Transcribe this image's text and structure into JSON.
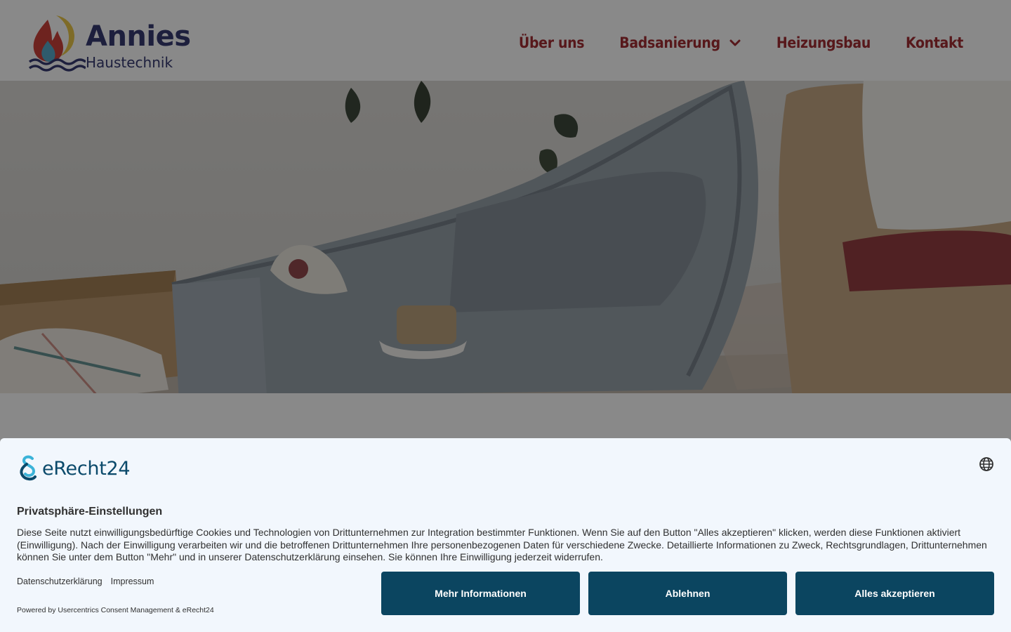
{
  "brand": {
    "name": "Annies",
    "subtitle": "Haustechnik",
    "colors": {
      "flame_red": "#c8322a",
      "flame_blue": "#4aa3c4",
      "moon_yellow": "#e8c23a",
      "text_navy": "#262a66"
    }
  },
  "nav": {
    "items": [
      {
        "label": "Über uns"
      },
      {
        "label": "Badsanierung",
        "icon": "chevron-down-icon"
      },
      {
        "label": "Heizungsbau"
      },
      {
        "label": "Kontakt"
      }
    ],
    "color": "#9b1c22"
  },
  "hero": {
    "image": "bathtub-photo"
  },
  "consent": {
    "logo_text": "eRecht24",
    "language_icon": "globe-icon",
    "title": "Privatsphäre-Einstellungen",
    "text": "Diese Seite nutzt einwilligungsbedürftige Cookies und Technologien von Drittunternehmen zur Integration bestimmter Funktionen. Wenn Sie auf den Button \"Alles akzeptieren\" klicken, werden diese Funktionen aktiviert (Einwilligung). Nach der Einwilligung verarbeiten wir und die betroffenen Drittunternehmen Ihre personenbezogenen Daten für verschiedene Zwecke. Detaillierte Informationen zu Zweck, Rechtsgrundlagen, Drittunternehmen können Sie unter dem Button \"Mehr\" und in unserer Datenschutzerklärung einsehen. Sie können Ihre Einwilligung jederzeit widerrufen.",
    "links": {
      "privacy": "Datenschutzerklärung",
      "imprint": "Impressum"
    },
    "powered_by": "Powered by Usercentrics Consent Management & eRecht24",
    "buttons": {
      "more": "Mehr Informationen",
      "deny": "Ablehnen",
      "accept": "Alles akzeptieren"
    },
    "button_color": "#0b4560",
    "background": "#f2f7fd"
  }
}
